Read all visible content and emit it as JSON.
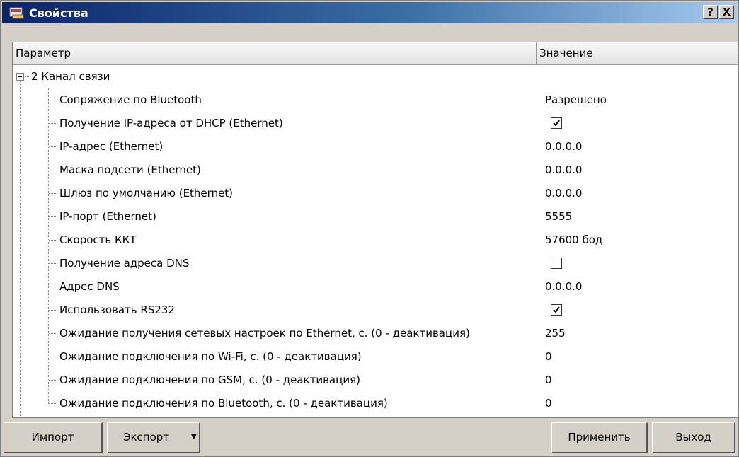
{
  "window": {
    "title": "Свойства",
    "help_label": "?",
    "close_label": "X"
  },
  "columns": {
    "param": "Параметр",
    "value": "Значение"
  },
  "tree": {
    "root_label": "2 Канал связи",
    "items": [
      {
        "label": "Сопряжение по Bluetooth",
        "value": "Разрешено"
      },
      {
        "label": "Получение IP-адреса от DHCP (Ethernet)",
        "checked": true
      },
      {
        "label": "IP-адрес (Ethernet)",
        "value": "0.0.0.0"
      },
      {
        "label": "Маска подсети (Ethernet)",
        "value": "0.0.0.0"
      },
      {
        "label": "Шлюз по умолчанию (Ethernet)",
        "value": "0.0.0.0"
      },
      {
        "label": "IP-порт (Ethernet)",
        "value": "5555"
      },
      {
        "label": "Скорость ККТ",
        "value": "57600 бод"
      },
      {
        "label": "Получение адреса DNS",
        "checked": false
      },
      {
        "label": "Адрес DNS",
        "value": "0.0.0.0"
      },
      {
        "label": "Использовать RS232",
        "checked": true
      },
      {
        "label": "Ожидание получения сетевых настроек по Ethernet, с. (0 - деактивация)",
        "value": "255"
      },
      {
        "label": "Ожидание подключения по Wi-Fi, с. (0 - деактивация)",
        "value": "0"
      },
      {
        "label": "Ожидание подключения по GSM, с. (0 - деактивация)",
        "value": "0"
      },
      {
        "label": "Ожидание подключения по Bluetooth, с. (0 - деактивация)",
        "value": "0"
      }
    ]
  },
  "buttons": {
    "import": "Импорт",
    "export": "Экспорт",
    "apply": "Применить",
    "exit": "Выход"
  },
  "colors": {
    "titlebar_start": "#0a246a",
    "titlebar_end": "#a6caf0",
    "window_bg": "#d4d0c8"
  }
}
